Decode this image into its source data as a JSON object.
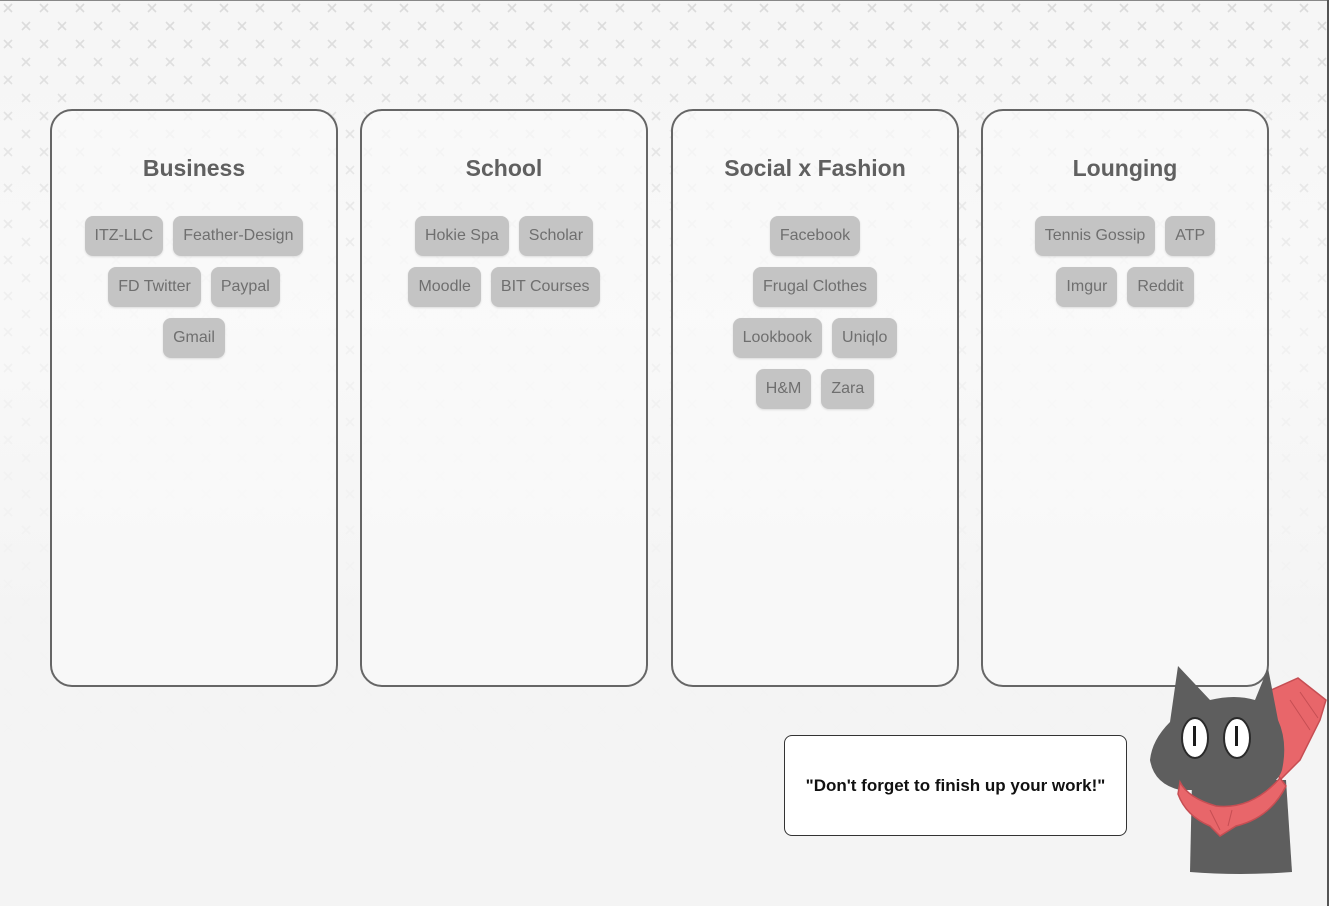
{
  "colors": {
    "background": "#f4f4f4",
    "pattern": "#d9d9d9",
    "column_border": "#666666",
    "title": "#606060",
    "chip_bg": "#c4c4c4",
    "chip_text": "#6f6f6f",
    "cat_body": "#5e5e5e",
    "scarf": "#e8666a"
  },
  "columns": [
    {
      "title": "Business",
      "links": [
        "ITZ-LLC",
        "Feather-Design",
        "FD Twitter",
        "Paypal",
        "Gmail"
      ]
    },
    {
      "title": "School",
      "links": [
        "Hokie Spa",
        "Scholar",
        "Moodle",
        "BIT Courses"
      ]
    },
    {
      "title": "Social x Fashion",
      "links": [
        "Facebook",
        "Frugal Clothes",
        "Lookbook",
        "Uniqlo",
        "H&M",
        "Zara"
      ]
    },
    {
      "title": "Lounging",
      "links": [
        "Tennis Gossip",
        "ATP",
        "Imgur",
        "Reddit"
      ]
    }
  ],
  "speech": {
    "text": "\"Don't forget to finish up your work!\""
  },
  "icons": {
    "mascot": "black-cat-with-red-scarf"
  }
}
